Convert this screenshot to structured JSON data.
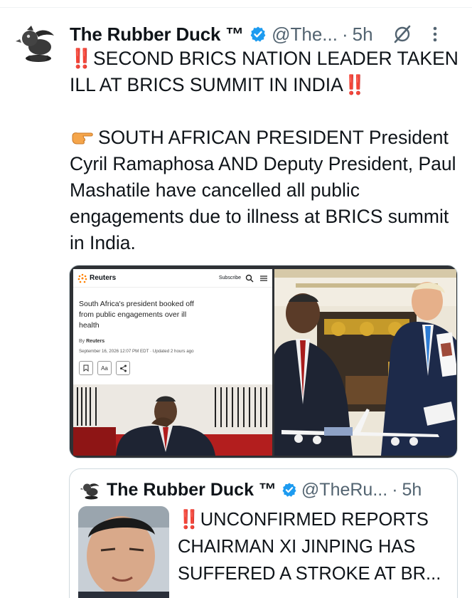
{
  "tweet": {
    "display_name": "The Rubber Duck ™",
    "handle": "@The...",
    "separator": "·",
    "time": "5h",
    "bang": "‼️",
    "headline": "SECOND BRICS NATION LEADER TAKEN ILL AT BRICS SUMMIT IN INDIA",
    "body": "SOUTH AFRICAN PRESIDENT President Cyril Ramaphosa AND Deputy President, Paul Mashatile have cancelled all public engagements due to illness at BRICS summit in India."
  },
  "media": {
    "reuters": {
      "logo": "Reuters",
      "subscribe": "Subscribe",
      "headline": "South Africa's president booked off from public engagements over ill health",
      "by_prefix": "By ",
      "byline": "Reuters",
      "date": "September 16, 2026 12:07 PM EDT · Updated 2 hours ago",
      "tool_font": "Aa"
    }
  },
  "quote": {
    "display_name": "The Rubber Duck ™",
    "handle": "@TheRu...",
    "separator": "·",
    "time": "5h",
    "bang": "‼️",
    "text": "UNCONFIRMED REPORTS CHAIRMAN XI JINPING HAS SUFFERED A STROKE AT BR..."
  },
  "colors": {
    "text": "#0f1419",
    "secondary": "#536471",
    "verified": "#1d9bf0",
    "bang": "#e0242b",
    "border": "#cfd9de"
  },
  "icons": [
    "rubber-duck-avatar",
    "verified-badge-icon",
    "grok-icon",
    "more-icon",
    "backhand-pointing-right-icon",
    "bookmark-icon",
    "share-icon",
    "search-icon",
    "menu-icon"
  ]
}
